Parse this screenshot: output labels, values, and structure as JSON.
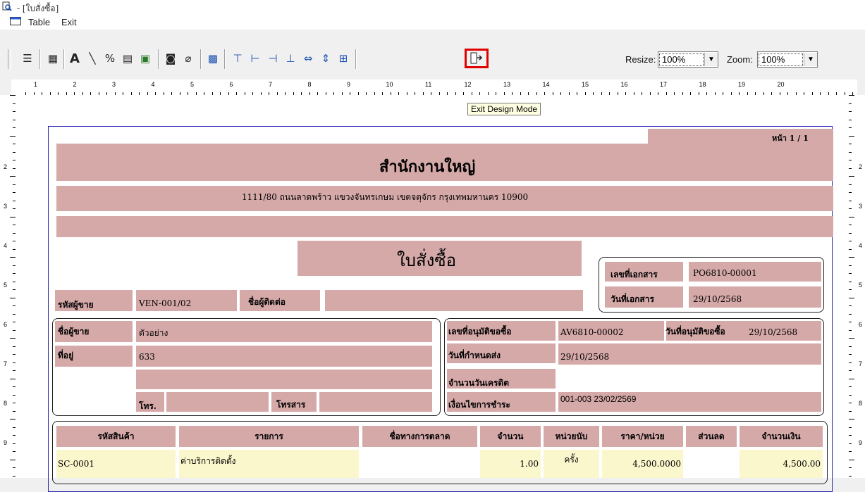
{
  "window": {
    "title": "- [ใบสั่งซื้อ]"
  },
  "menu": {
    "items": [
      "Table",
      "Exit"
    ]
  },
  "toolbar": {
    "resize_label": "Resize:",
    "resize_value": "100%",
    "zoom_label": "Zoom:",
    "zoom_value": "100%",
    "tooltip": "Exit Design Mode"
  },
  "ruler": {
    "h_numbers": [
      "1",
      "2",
      "3",
      "4",
      "5",
      "6",
      "7",
      "8",
      "9",
      "10",
      "11",
      "12",
      "13",
      "14",
      "15",
      "16",
      "17",
      "18",
      "19",
      "20"
    ],
    "v_numbers": [
      "2",
      "3",
      "4",
      "5",
      "6",
      "7",
      "8",
      "9"
    ]
  },
  "report": {
    "page": "หน้า 1 / 1",
    "company": "สำนักงานใหญ่",
    "address": "1111/80 ถนนลาดพร้าว แขวงจันทรเกษม เขตจตุจักร กรุงเทพมหานคร 10900",
    "doc_title": "ใบสั่งซื้อ",
    "doc_no_label": "เลขที่เอกสาร",
    "doc_no": "PO6810-00001",
    "doc_date_label": "วันที่เอกสาร",
    "doc_date": "29/10/2568",
    "vendor_code_label": "รหัสผู้ขาย",
    "vendor_code": "VEN-001/02",
    "contact_label": "ชื่อผู้ติดต่อ",
    "vendor_name_label": "ชื่อผู้ขาย",
    "vendor_name": "ตัวอย่าง",
    "address_label": "ที่อยู่",
    "address_value": "633",
    "tel_label": "โทร.",
    "fax_label": "โทรสาร",
    "pr_no_label": "เลขที่อนุมัติขอซื้อ",
    "pr_no": "AV6810-00002",
    "pr_date_label": "วันที่อนุมัติขอซื้อ",
    "pr_date": "29/10/2568",
    "due_label": "วันที่กำหนดส่ง",
    "due_date": "29/10/2568",
    "credit_label": "จำนวนวันเครดิต",
    "terms_label": "เงื่อนไขการชำระ",
    "terms": "001-003 23/02/2569",
    "columns": [
      "รหัสสินค้า",
      "รายการ",
      "ชื่อทางการตลาด",
      "จำนวน",
      "หน่วยนับ",
      "ราคา/หน่วย",
      "ส่วนลด",
      "จำนวนเงิน"
    ],
    "rows": [
      {
        "code": "SC-0001",
        "desc": "ค่าบริการติดตั้ง",
        "market": "",
        "qty": "1.00",
        "unit": "ครั้ง",
        "price": "4,500.0000",
        "disc": "",
        "amount": "4,500.00"
      }
    ]
  },
  "colors": {
    "band": "#d6a9a9",
    "highlight": "#e00000",
    "row": "#fbf7cc"
  }
}
